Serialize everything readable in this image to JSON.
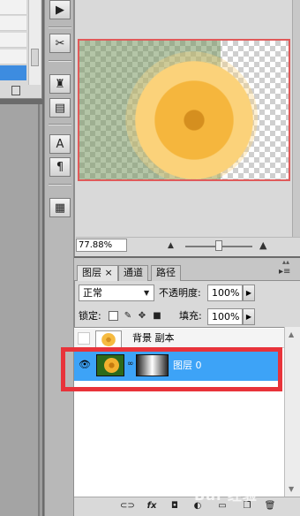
{
  "navigator": {
    "zoom": "77.88%"
  },
  "layers": {
    "tabs": [
      {
        "label": "图层",
        "close": "×"
      },
      {
        "label": "通道"
      },
      {
        "label": "路径"
      }
    ],
    "blend_mode": "正常",
    "opacity_label": "不透明度:",
    "opacity_value": "100%",
    "lock_label": "锁定:",
    "fill_label": "填充:",
    "fill_value": "100%",
    "items": [
      {
        "name": "背景 副本",
        "visible": false,
        "selected": false
      },
      {
        "name": "图层 0",
        "visible": true,
        "selected": true
      }
    ]
  },
  "tool_icons": [
    "play-icon",
    "tools-icon",
    "stamp-icon",
    "clone-icon",
    "type-icon",
    "paragraph-icon",
    "notes-icon"
  ],
  "footer_icons": [
    "link-icon",
    "fx-icon",
    "mask-icon",
    "adjustment-icon",
    "folder-icon",
    "new-layer-icon",
    "trash-icon"
  ],
  "watermark": "Bai 经验",
  "colors": {
    "selection": "#3da3f7",
    "highlight": "#e8333a",
    "preview_border": "#e05a5a"
  }
}
